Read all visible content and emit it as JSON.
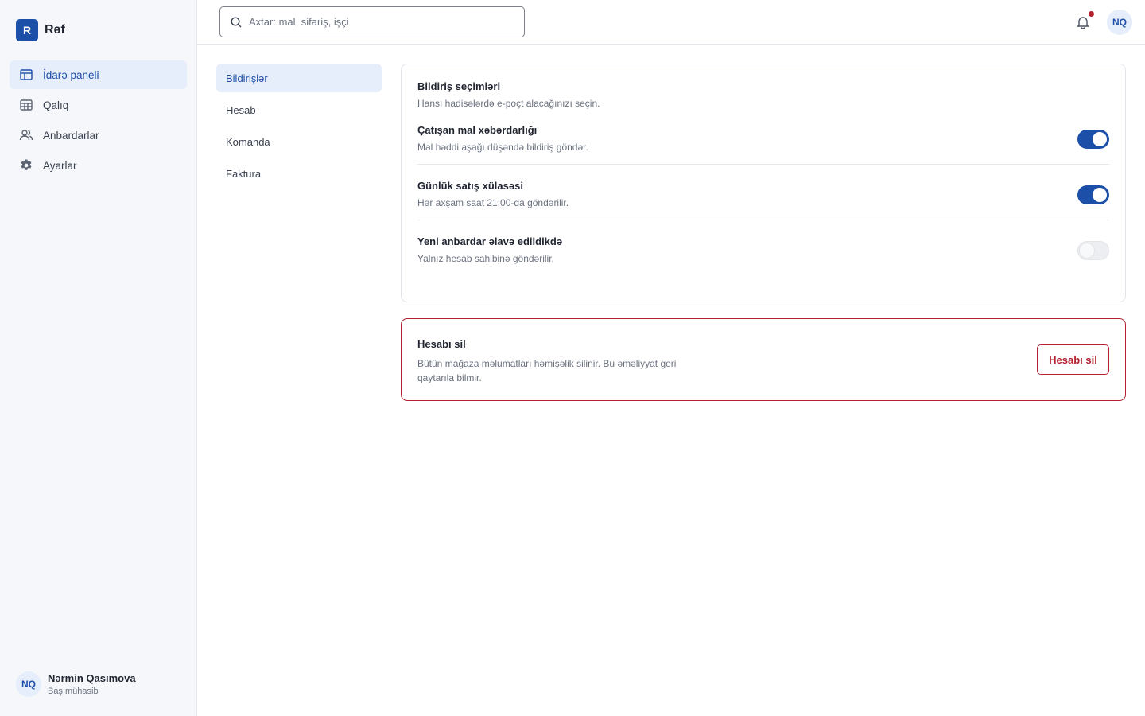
{
  "app": {
    "logo_letter": "R",
    "name": "Rəf"
  },
  "sidebar": {
    "items": [
      {
        "label": "İdarə paneli",
        "icon": "dashboard-icon",
        "active": true
      },
      {
        "label": "Qalıq",
        "icon": "inventory-icon",
        "active": false
      },
      {
        "label": "Anbardarlar",
        "icon": "users-icon",
        "active": false
      },
      {
        "label": "Ayarlar",
        "icon": "gear-icon",
        "active": false
      }
    ],
    "user": {
      "initials": "NQ",
      "name": "Nərmin Qasımova",
      "role": "Baş mühasib"
    }
  },
  "topbar": {
    "search_placeholder": "Axtar: mal, sifariş, işçi",
    "avatar_initials": "NQ",
    "has_notification": true
  },
  "settings_nav": {
    "items": [
      {
        "label": "Bildirişlər",
        "active": true
      },
      {
        "label": "Hesab",
        "active": false
      },
      {
        "label": "Komanda",
        "active": false
      },
      {
        "label": "Faktura",
        "active": false
      }
    ]
  },
  "notifications": {
    "title": "Bildiriş seçimləri",
    "subtitle": "Hansı hadisələrdə e-poçt alacağınızı seçin.",
    "options": [
      {
        "title": "Çatışan mal xəbərdarlığı",
        "description": "Mal həddi aşağı düşəndə bildiriş göndər.",
        "enabled": true
      },
      {
        "title": "Günlük satış xülasəsi",
        "description": "Hər axşam saat 21:00-da göndərilir.",
        "enabled": true
      },
      {
        "title": "Yeni anbardar əlavə edildikdə",
        "description": "Yalnız hesab sahibinə göndərilir.",
        "enabled": false
      }
    ]
  },
  "danger_zone": {
    "title": "Hesabı sil",
    "description": "Bütün mağaza məlumatları həmişəlik silinir. Bu əməliyyat geri qaytarıla bilmir.",
    "button_label": "Hesabı sil"
  },
  "colors": {
    "accent": "#1c4fa8",
    "danger": "#b3202e",
    "sidebar_bg": "#f5f7fa"
  }
}
